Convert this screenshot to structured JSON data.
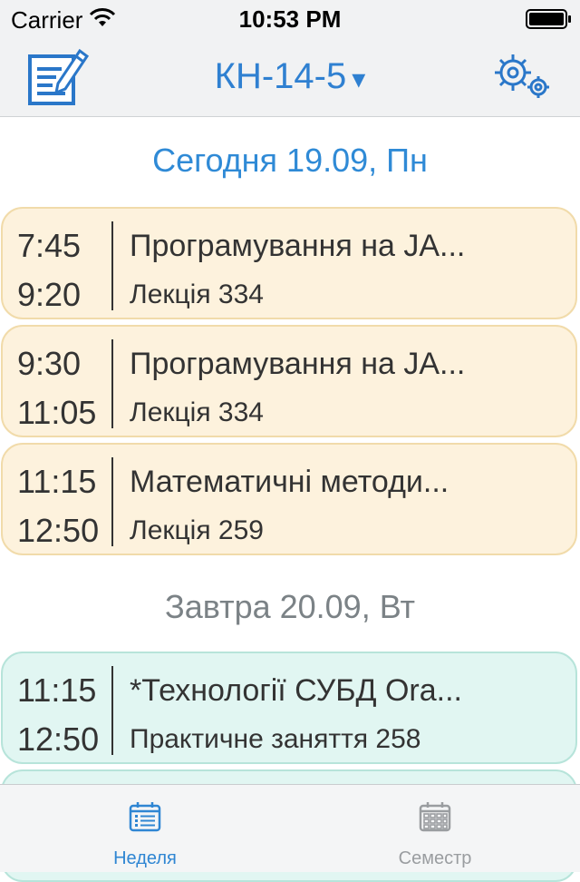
{
  "status_bar": {
    "carrier": "Carrier",
    "time": "10:53 PM"
  },
  "nav": {
    "group": "КН-14-5",
    "caret": "▾"
  },
  "today_header": "Сегодня 19.09, Пн",
  "today_lessons": [
    {
      "start": "7:45",
      "end": "9:20",
      "subject": "Програмування на JA...",
      "room": "Лекція 334"
    },
    {
      "start": "9:30",
      "end": "11:05",
      "subject": "Програмування на JA...",
      "room": "Лекція 334"
    },
    {
      "start": "11:15",
      "end": "12:50",
      "subject": "Математичні методи...",
      "room": "Лекція 259"
    }
  ],
  "tomorrow_header": "Завтра 20.09, Вт",
  "tomorrow_lessons": [
    {
      "start": "11:15",
      "end": "12:50",
      "subject": "*Технології СУБД Ora...",
      "room": "Практичне заняття 258"
    }
  ],
  "tabs": {
    "week": "Неделя",
    "semester": "Семестр"
  },
  "colors": {
    "accent": "#2f80d1",
    "today_card": "#fdf2dd",
    "tomorrow_card": "#e1f6f2"
  }
}
